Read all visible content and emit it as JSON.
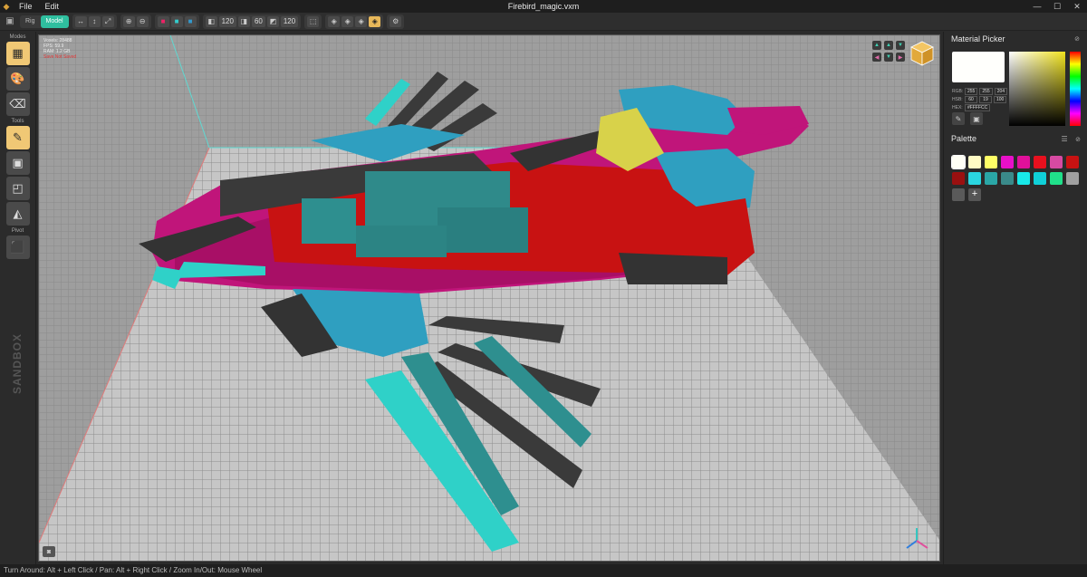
{
  "titlebar": {
    "menu": [
      "File",
      "Edit"
    ],
    "title": "Firebird_magic.vxm",
    "controls": [
      "—",
      "☐",
      "✕"
    ]
  },
  "toolbar": {
    "mode_rig": "Rig",
    "mode_model": "Model",
    "size_x": "120",
    "size_y": "60",
    "size_z": "120"
  },
  "leftbar": {
    "modes_label": "Modes",
    "tools_label": "Tools",
    "pivot_label": "Pivot",
    "logo": "SANDBOX"
  },
  "viewport": {
    "stats": [
      "Voxels: 28488",
      "FPS: 59.9",
      "RAM: 1.2 GB"
    ],
    "warning": "Save Not Saved"
  },
  "material_picker": {
    "title": "Material Picker",
    "current_color": "#FFFFFC",
    "rgb_label": "RGB:",
    "rgb": [
      "255",
      "255",
      "204"
    ],
    "hsb_label": "HSB:",
    "hsb": [
      "60",
      "19",
      "100"
    ],
    "hex_label": "HEX:",
    "hex": "#FFFFCC"
  },
  "palette": {
    "title": "Palette",
    "colors": [
      "#fffff5",
      "#fffbc4",
      "#ffff66",
      "#e810c8",
      "#e0109a",
      "#e8101e",
      "#d64aa2",
      "#c81212",
      "#9a1010",
      "#2ad6e0",
      "#2aa6a6",
      "#3a8a8a",
      "#18e8e8",
      "#10d0d8",
      "#20e08a",
      "#a0a0a0",
      "#5a5a5a"
    ],
    "add_label": "+"
  },
  "statusbar": {
    "text": "Turn Around: Alt + Left Click / Pan: Alt + Right Click / Zoom In/Out: Mouse Wheel"
  }
}
